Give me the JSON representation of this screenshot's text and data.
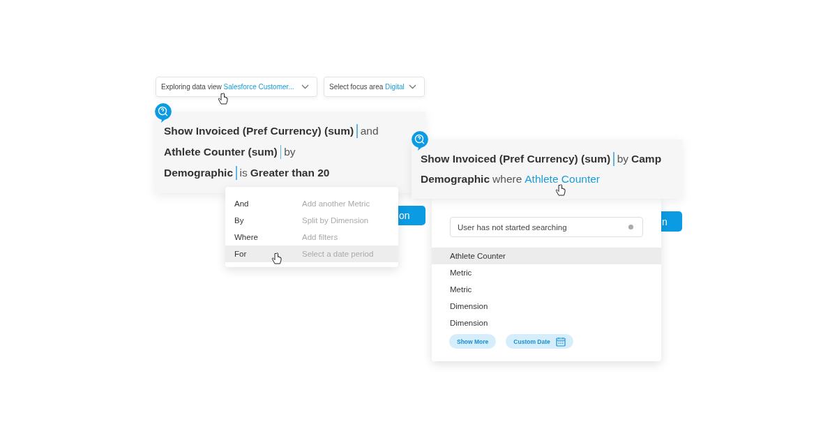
{
  "dropdowns": [
    {
      "label": "Exploring data view",
      "value": "Salesforce Customer..."
    },
    {
      "label": "Select focus area",
      "value": "Digital"
    }
  ],
  "query_left": {
    "lines": [
      [
        {
          "kind": "bold",
          "text": "Show Invoiced (Pref Currency) (sum)"
        },
        {
          "kind": "cursor"
        },
        {
          "kind": "plain",
          "text": "and"
        }
      ],
      [
        {
          "kind": "bold",
          "text": "Athlete Counter (sum)"
        },
        {
          "kind": "cursor"
        },
        {
          "kind": "plain",
          "text": "by"
        }
      ],
      [
        {
          "kind": "bold",
          "text": "Demographic"
        },
        {
          "kind": "cursor"
        },
        {
          "kind": "plain",
          "text": "is"
        },
        {
          "kind": "bold",
          "text": "Greater than 20"
        }
      ]
    ]
  },
  "button_left": {
    "label": "on"
  },
  "keyword_menu": [
    {
      "keyword": "And",
      "hint": "Add another Metric",
      "selected": false
    },
    {
      "keyword": "By",
      "hint": "Split by Dimension",
      "selected": false
    },
    {
      "keyword": "Where",
      "hint": "Add filters",
      "selected": false
    },
    {
      "keyword": "For",
      "hint": "Select a date period",
      "selected": true
    }
  ],
  "query_right": {
    "lines": [
      [
        {
          "kind": "bold",
          "text": "Show Invoiced (Pref Currency) (sum)"
        },
        {
          "kind": "cursor"
        },
        {
          "kind": "plain",
          "text": "by"
        },
        {
          "kind": "bold",
          "text": "Camp"
        }
      ],
      [
        {
          "kind": "bold",
          "text": "Demographic"
        },
        {
          "kind": "plain",
          "text": "where"
        },
        {
          "kind": "link",
          "text": "Athlete Counter"
        }
      ]
    ]
  },
  "button_right": {
    "label": "n"
  },
  "suggestions": {
    "search": {
      "value": "User has not started searching"
    },
    "items": [
      {
        "label": "Athlete Counter",
        "selected": true
      },
      {
        "label": "Metric",
        "selected": false
      },
      {
        "label": "Metric",
        "selected": false
      },
      {
        "label": "Dimension",
        "selected": false
      },
      {
        "label": "Dimension",
        "selected": false
      }
    ],
    "chips": [
      {
        "label": "Show More",
        "kind": "plain"
      },
      {
        "label": "Custom Date",
        "kind": "calendar"
      }
    ]
  }
}
